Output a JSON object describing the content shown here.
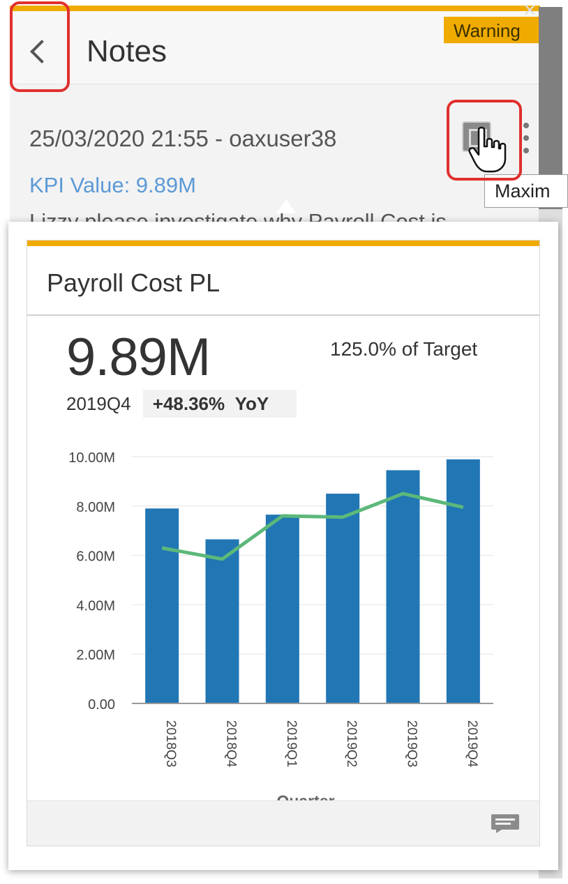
{
  "notes": {
    "title": "Notes",
    "warning_tag": "Warning",
    "note_meta": "25/03/2020 21:55 - oaxuser38",
    "kpi_value_link": "KPI Value: 9.89M",
    "note_text": "Lizzy please investigate why Payroll Cost is",
    "tooltip": "Maxim",
    "close_symbol": "×"
  },
  "icons": {
    "back": "chevron-left-icon",
    "maximize": "maximize-icon",
    "overflow": "vertical-ellipsis-icon",
    "cursor": "hand-pointer-cursor",
    "comment": "comment-icon"
  },
  "tile": {
    "title": "Payroll Cost PL",
    "kpi_value": "9.89M",
    "target_text": "125.0% of Target",
    "period": "2019Q4",
    "yoy_value": "+48.36%",
    "yoy_label": "YoY"
  },
  "colors": {
    "accent_stripe": "#f0ab00",
    "bar": "#2176b4",
    "line": "#5cb87a",
    "link": "#5c9ad6",
    "highlight": "#e0302e"
  },
  "chart_data": {
    "type": "bar",
    "categories": [
      "2018Q3",
      "2018Q4",
      "2019Q1",
      "2019Q2",
      "2019Q3",
      "2019Q4"
    ],
    "series": [
      {
        "type": "bar",
        "values": [
          7.9,
          6.65,
          7.65,
          8.5,
          9.45,
          9.89
        ]
      },
      {
        "type": "line",
        "values": [
          6.3,
          5.85,
          7.6,
          7.55,
          8.5,
          7.95
        ]
      }
    ],
    "y_ticks": [
      "10.00M",
      "8.00M",
      "6.00M",
      "4.00M",
      "2.00M",
      "0.00"
    ],
    "ylim": [
      0,
      10
    ],
    "xlabel": "Quarter",
    "ylabel": "",
    "grid": true
  }
}
